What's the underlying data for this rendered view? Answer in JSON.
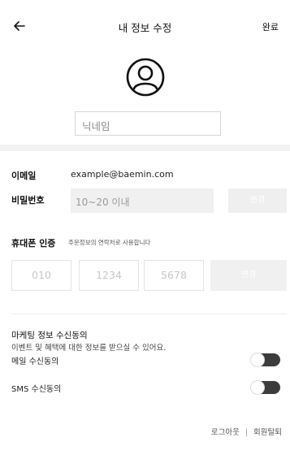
{
  "header": {
    "title": "내 정보 수정",
    "done_label": "완료"
  },
  "profile": {
    "nickname_placeholder": "닉네임"
  },
  "email": {
    "label": "이메일",
    "value": "example@baemin.com"
  },
  "password": {
    "label": "비밀번호",
    "placeholder": "10~20 이내",
    "change_label": "변경"
  },
  "phone": {
    "label": "휴대폰 인증",
    "hint": "주문정보의 연락처로 사용합니다",
    "parts": [
      "010",
      "1234",
      "5678"
    ],
    "change_label": "변경"
  },
  "marketing": {
    "title": "마케팅 정보 수신동의",
    "description": "이벤트 및 혜택에 대한 정보를 받으실 수 있어요.",
    "email_label": "메일 수신동의",
    "sms_label": "SMS 수신동의"
  },
  "footer": {
    "logout": "로그아웃",
    "separator": "|",
    "withdraw": "회원탈퇴"
  },
  "icons": {
    "back": "arrow-left-icon",
    "avatar": "user-circle-icon"
  }
}
